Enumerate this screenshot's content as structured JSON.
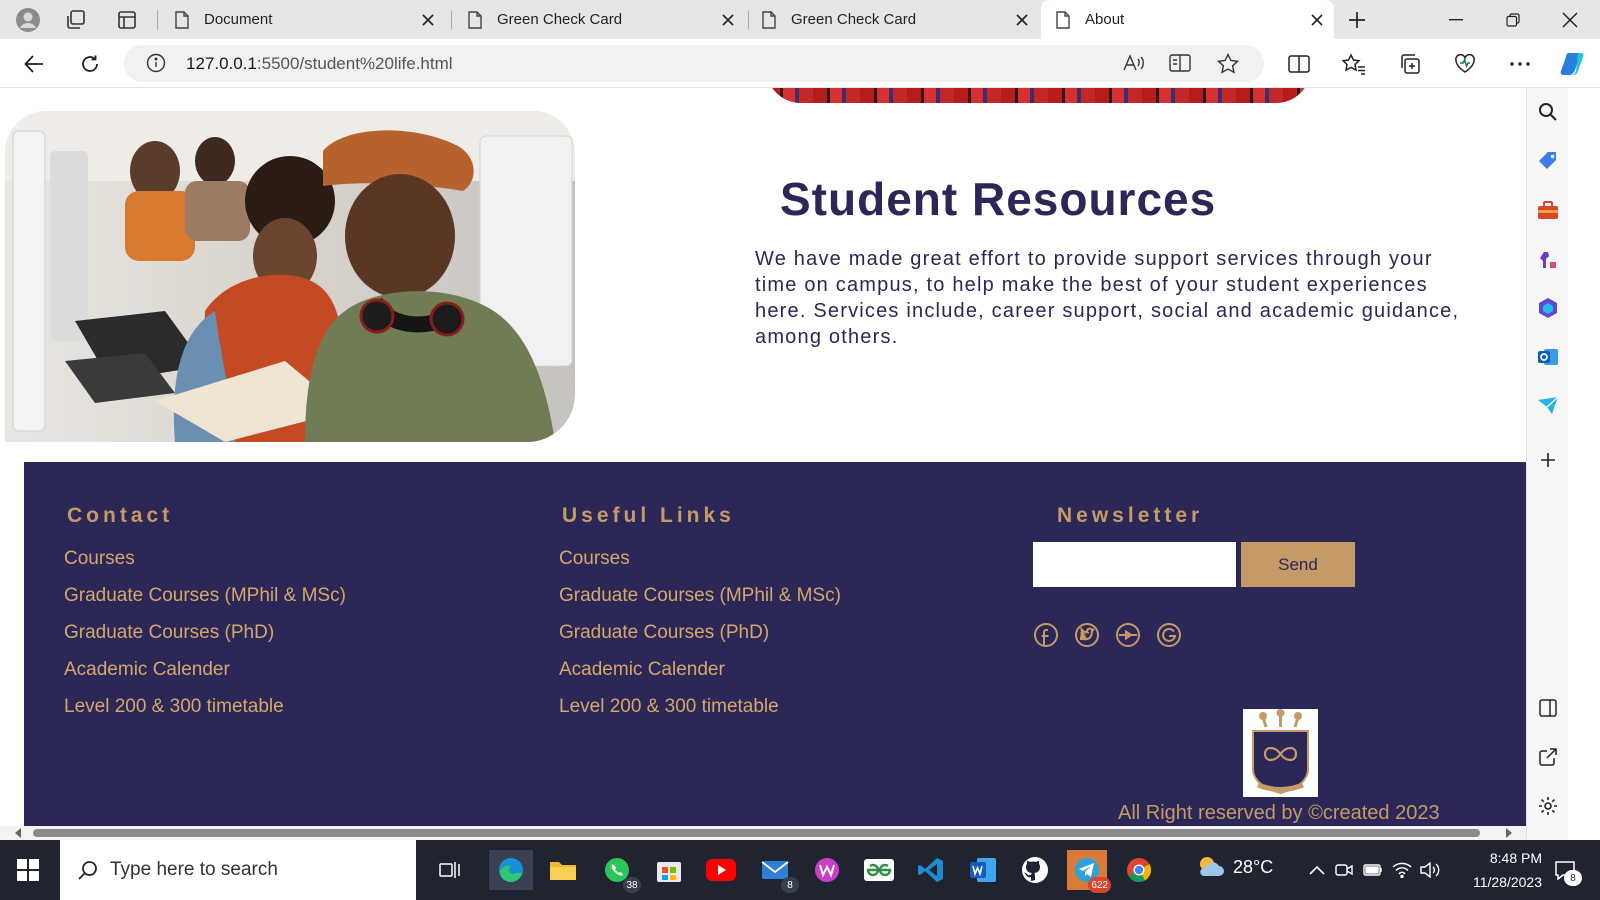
{
  "browser": {
    "tabs": [
      {
        "title": "Document",
        "active": false
      },
      {
        "title": "Green Check Card",
        "active": false
      },
      {
        "title": "Green Check Card",
        "active": false
      },
      {
        "title": "About",
        "active": true
      }
    ],
    "url_host": "127.0.0.1",
    "url_path": ":5500/student%20life.html"
  },
  "page": {
    "resources_title": "Student Resources",
    "resources_text": "We have made great effort to provide support services through your time on campus, to help make the best of your student experiences here. Services include, career support, social and academic guidance, among others.",
    "footer": {
      "contact_heading": "Contact",
      "contact_links": [
        "Courses",
        "Graduate Courses (MPhil & MSc)",
        "Graduate Courses (PhD)",
        "Academic Calender",
        "Level 200 & 300 timetable"
      ],
      "useful_heading": "Useful Links",
      "useful_links": [
        "Courses",
        "Graduate Courses (MPhil & MSc)",
        "Graduate Courses (PhD)",
        "Academic Calender",
        "Level 200 & 300 timetable"
      ],
      "newsletter_heading": "Newsletter",
      "newsletter_value": "",
      "send_label": "Send",
      "social_icons": [
        "facebook-icon",
        "twitter-icon",
        "youtube-icon",
        "google-icon"
      ],
      "copyright": "All Right reserved by ©created 2023"
    },
    "colors": {
      "navy": "#2b2757",
      "gold": "#c49a66",
      "link": "#d4a76a"
    }
  },
  "taskbar": {
    "search_placeholder": "Type here to search",
    "whatsapp_badge": "38",
    "mail_badge": "8",
    "telegram_badge": "622",
    "temperature": "28°C",
    "time": "8:48 PM",
    "date": "11/28/2023",
    "notification_count": "8"
  }
}
